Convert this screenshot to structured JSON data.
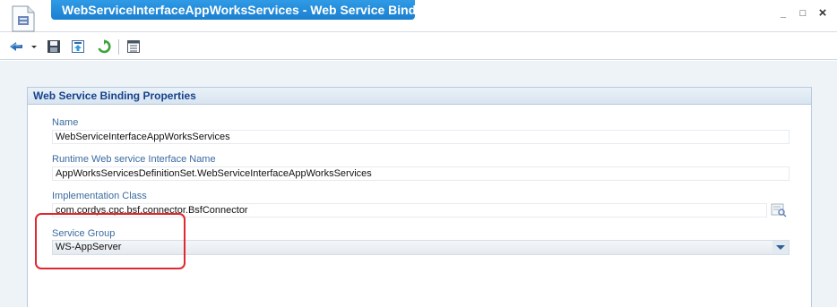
{
  "window": {
    "title": "WebServiceInterfaceAppWorksServices - Web Service Binding*",
    "minimize_label": "_",
    "restore_label": "□",
    "close_label": "×"
  },
  "toolbar": {
    "icons": [
      "navigate-icon",
      "dropdown-icon",
      "save-icon",
      "publish-icon",
      "refresh-icon",
      "properties-icon"
    ]
  },
  "panel": {
    "title": "Web Service Binding Properties",
    "fields": [
      {
        "label": "Name",
        "value": "WebServiceInterfaceAppWorksServices"
      },
      {
        "label": "Runtime Web service Interface Name",
        "value": "AppWorksServicesDefinitionSet.WebServiceInterfaceAppWorksServices"
      },
      {
        "label": "Implementation Class",
        "value": "com.cordys.cpc.bsf.connector.BsfConnector"
      },
      {
        "label": "Service Group",
        "value": "WS-AppServer"
      }
    ]
  },
  "colors": {
    "title_tab": "#1b7fd0",
    "label_text": "#3b6aa0",
    "panel_header_text": "#15428b",
    "highlight": "#e0282e"
  }
}
